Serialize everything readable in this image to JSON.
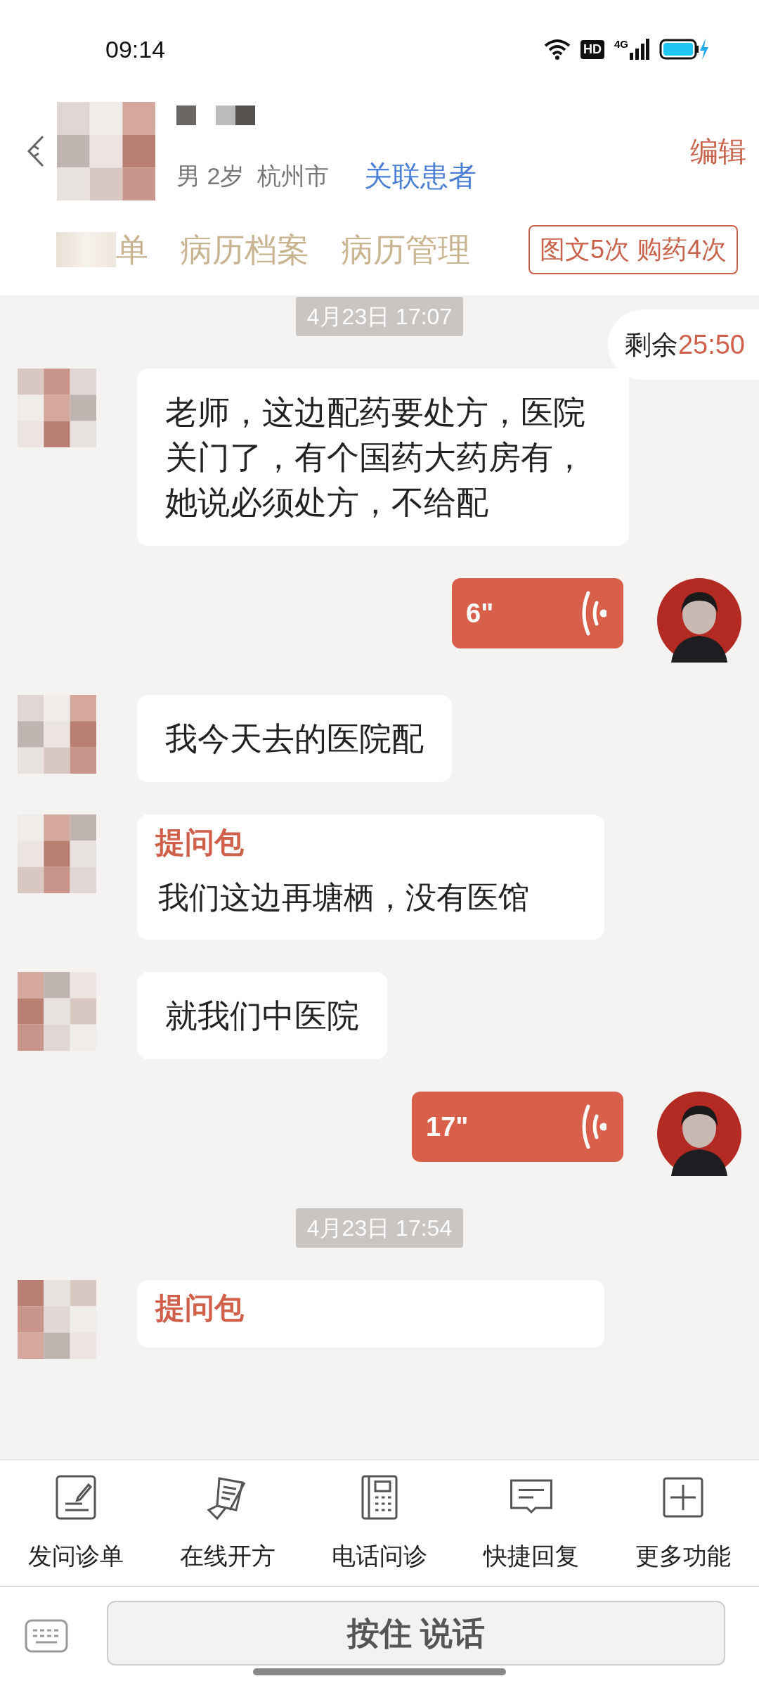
{
  "status_bar": {
    "time": "09:14",
    "hd": "HD",
    "network": "4G"
  },
  "header": {
    "info": "男 2岁  杭州市",
    "link": "关联患者",
    "edit": "编辑"
  },
  "tabs": [
    {
      "label": "单",
      "blurred": true
    },
    {
      "label": "病历档案",
      "blurred": false
    },
    {
      "label": "病历管理",
      "blurred": false
    }
  ],
  "usage_badge": "图文5次 购药4次",
  "timer": {
    "label": "剩余",
    "value": "25:50"
  },
  "messages": [
    {
      "kind": "time",
      "text": "4月23日 17:07"
    },
    {
      "kind": "text",
      "text": "老师，这边配药要处方，医院关门了，有个国药大药房有，她说必须处方，不给配"
    },
    {
      "kind": "voice",
      "text": "6\""
    },
    {
      "kind": "text",
      "text": "我今天去的医院配"
    },
    {
      "kind": "question",
      "title": "提问包",
      "text": "我们这边再塘栖，没有医馆"
    },
    {
      "kind": "text",
      "text": "就我们中医院"
    },
    {
      "kind": "voice",
      "text": "17\""
    },
    {
      "kind": "time",
      "text": "4月23日 17:54"
    },
    {
      "kind": "question",
      "title": "提问包"
    }
  ],
  "toolbar": [
    {
      "kind": "form",
      "label": "发问诊单"
    },
    {
      "kind": "prescription",
      "label": "在线开方"
    },
    {
      "kind": "phone",
      "label": "电话问诊"
    },
    {
      "kind": "reply",
      "label": "快捷回复"
    },
    {
      "kind": "more",
      "label": "更多功能"
    }
  ],
  "input_bar": {
    "button": "按住 说话"
  }
}
